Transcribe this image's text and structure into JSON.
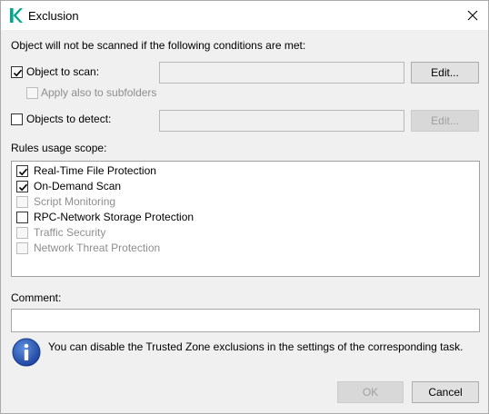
{
  "window": {
    "title": "Exclusion",
    "accent_color": "#00a88e",
    "icons": {
      "app": "kaspersky-k-icon",
      "close": "close-icon",
      "info": "info-icon",
      "check": "checkmark-icon"
    }
  },
  "conditions": {
    "header": "Object will not be scanned if the following conditions are met:",
    "object_to_scan": {
      "label": "Object to scan:",
      "checked": true,
      "value": "",
      "edit_label": "Edit..."
    },
    "apply_subfolders": {
      "label": "Apply also to subfolders",
      "checked": false,
      "enabled": false
    },
    "objects_to_detect": {
      "label": "Objects to detect:",
      "checked": false,
      "value": "",
      "edit_label": "Edit..."
    }
  },
  "scope": {
    "header": "Rules usage scope:",
    "items": [
      {
        "label": "Real-Time File Protection",
        "checked": true,
        "enabled": true
      },
      {
        "label": "On-Demand Scan",
        "checked": true,
        "enabled": true
      },
      {
        "label": "Script Monitoring",
        "checked": false,
        "enabled": false
      },
      {
        "label": "RPC-Network Storage Protection",
        "checked": false,
        "enabled": true
      },
      {
        "label": "Traffic Security",
        "checked": false,
        "enabled": false
      },
      {
        "label": "Network Threat Protection",
        "checked": false,
        "enabled": false
      }
    ]
  },
  "comment": {
    "label": "Comment:",
    "value": ""
  },
  "info": {
    "text": "You can disable the Trusted Zone exclusions in the settings of the corresponding task."
  },
  "footer": {
    "ok_label": "OK",
    "cancel_label": "Cancel"
  }
}
